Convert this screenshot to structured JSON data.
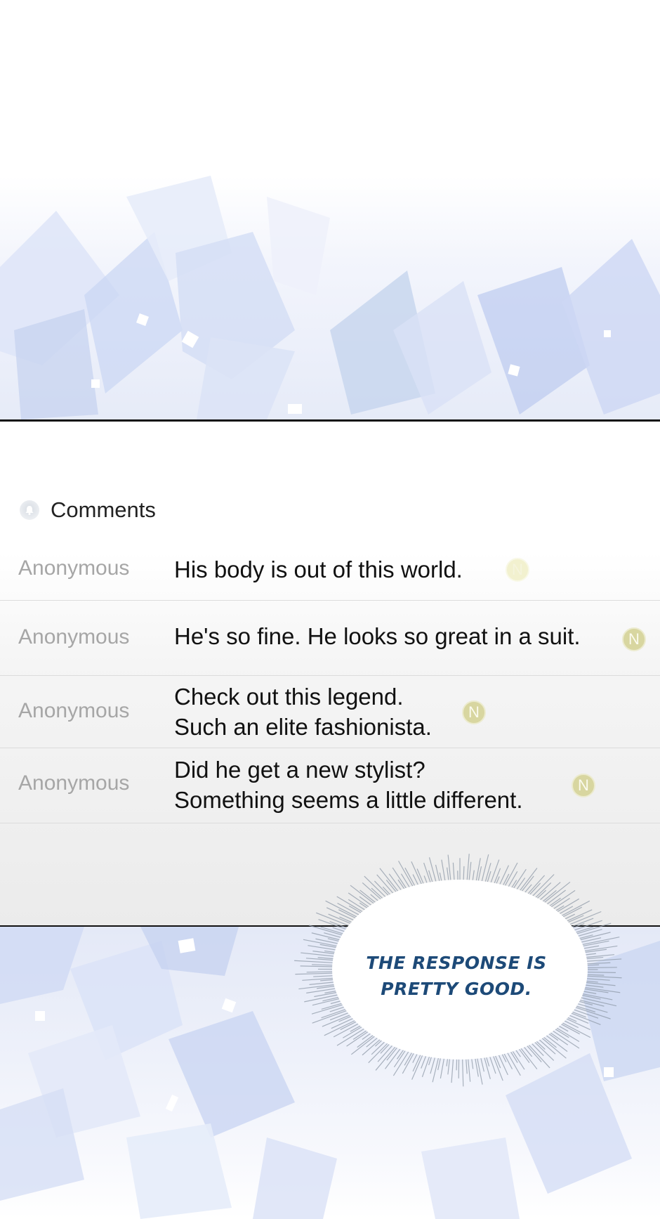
{
  "comments": {
    "title": "Comments",
    "items": [
      {
        "author": "Anonymous",
        "lines": [
          "His body is out of this world."
        ],
        "badge": "N"
      },
      {
        "author": "Anonymous",
        "lines": [
          "He's so fine. He looks so great in a suit."
        ],
        "badge": "N"
      },
      {
        "author": "Anonymous",
        "lines": [
          "Check out this legend.",
          "Such an elite fashionista."
        ],
        "badge": "N"
      },
      {
        "author": "Anonymous",
        "lines": [
          "Did he get a new stylist?",
          "Something seems a little different."
        ],
        "badge": "N"
      }
    ]
  },
  "speech_bubble": {
    "line1": "THE RESPONSE IS",
    "line2": "PRETTY GOOD."
  },
  "colors": {
    "crystal_blue": "#b9c8ee",
    "bubble_text": "#1d4a78",
    "badge": "#d8d6a0"
  }
}
